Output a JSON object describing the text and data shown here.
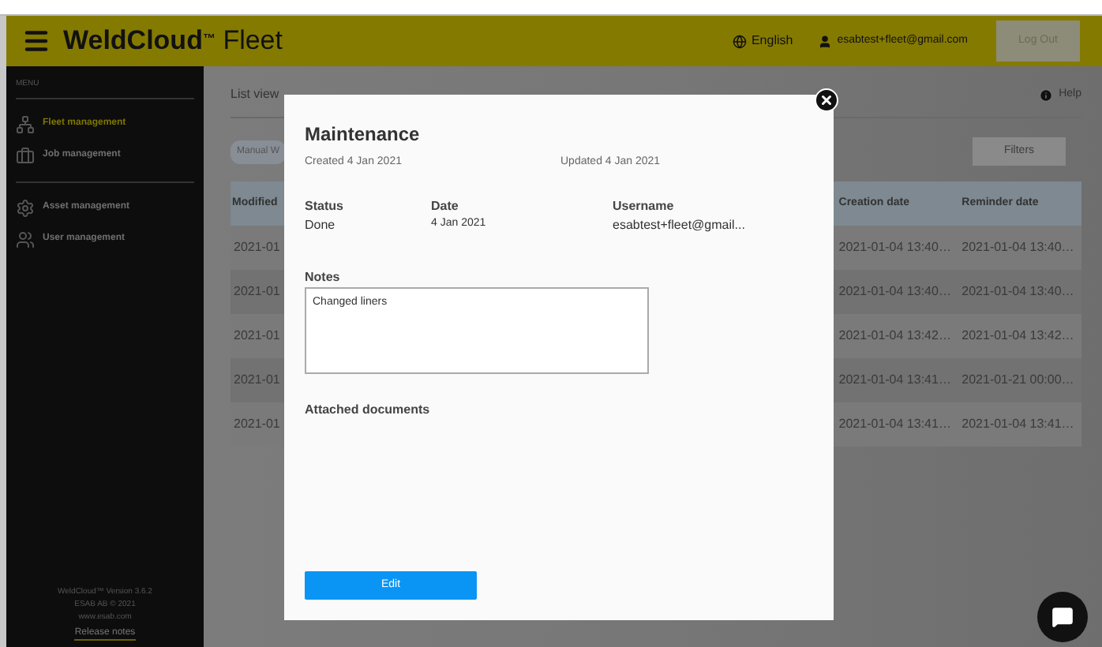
{
  "header": {
    "brand": "WeldCloud",
    "brand_mark": "™",
    "brand_suffix": "Fleet",
    "language": "English",
    "user": "esabtest+fleet@gmail.com",
    "logout": "Log Out"
  },
  "sidebar": {
    "menu_label": "MENU",
    "groups": [
      [
        {
          "label": "Fleet management",
          "selected": true
        },
        {
          "label": "Job management",
          "selected": false
        }
      ],
      [
        {
          "label": "Asset management",
          "selected": false
        },
        {
          "label": "User management",
          "selected": false
        }
      ]
    ],
    "footer": [
      "WeldCloud™ Version 3.6.2",
      "ESAB AB © 2021",
      "www.esab.com"
    ],
    "release_notes": "Release notes"
  },
  "main": {
    "tab": "List view",
    "chip": "Manual W",
    "help": "Help",
    "filters": "Filters",
    "table": {
      "columns": [
        "Modified",
        "Creation date",
        "Reminder date"
      ],
      "rows": [
        [
          "2021-01",
          "2021-01-04 13:40…",
          "2021-01-04 13:40…"
        ],
        [
          "2021-01",
          "2021-01-04 13:40…",
          "2021-01-04 13:40…"
        ],
        [
          "2021-01",
          "2021-01-04 13:42…",
          "2021-01-04 13:42…"
        ],
        [
          "2021-01",
          "2021-01-04 13:41…",
          "2021-01-21 00:00…"
        ],
        [
          "2021-01",
          "2021-01-04 13:41…",
          "2021-01-04 13:41…"
        ]
      ]
    }
  },
  "modal": {
    "title": "Maintenance",
    "created": "Created 4 Jan 2021",
    "updated": "Updated 4 Jan 2021",
    "fields": [
      {
        "label": "Status",
        "value": "Done"
      },
      {
        "label": "Date",
        "value": "4 Jan 2021"
      },
      {
        "label": "Username",
        "value": "esabtest+fleet@gmail..."
      }
    ],
    "notes_label": "Notes",
    "notes": "Changed liners",
    "attachments_label": "Attached documents",
    "edit": "Edit"
  }
}
